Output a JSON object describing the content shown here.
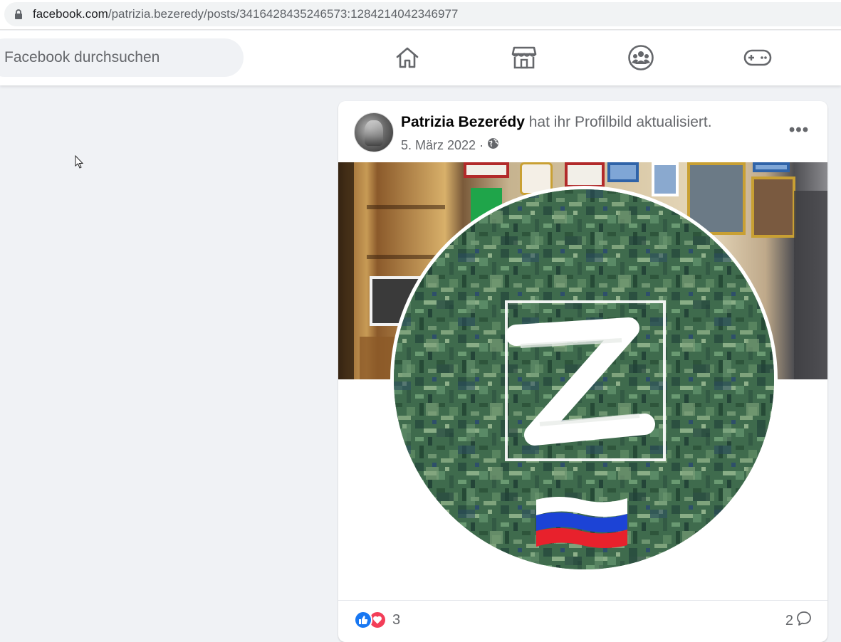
{
  "browser": {
    "url_host": "facebook.com",
    "url_path": "/patrizia.bezeredy/posts/3416428435246573:1284214042346977",
    "lock_icon": "lock-icon"
  },
  "nav": {
    "search_placeholder": "Facebook durchsuchen",
    "icons": [
      "home-icon",
      "marketplace-icon",
      "groups-icon",
      "gaming-icon"
    ]
  },
  "post": {
    "author": "Patrizia Bezerédy",
    "action": " hat ihr Profilbild aktualisiert.",
    "date": "5. März 2022",
    "separator": "·",
    "audience_icon": "globe-icon",
    "more_label": "•••",
    "reaction_count": "3",
    "reaction_icons": [
      "like-icon",
      "love-icon"
    ],
    "comment_count": "2",
    "comment_icon": "comment-icon"
  },
  "colors": {
    "fb_blue": "#1877f2",
    "love_red": "#f33e58",
    "page_bg": "#f0f2f5",
    "camo_green": "#3f6b4d"
  }
}
